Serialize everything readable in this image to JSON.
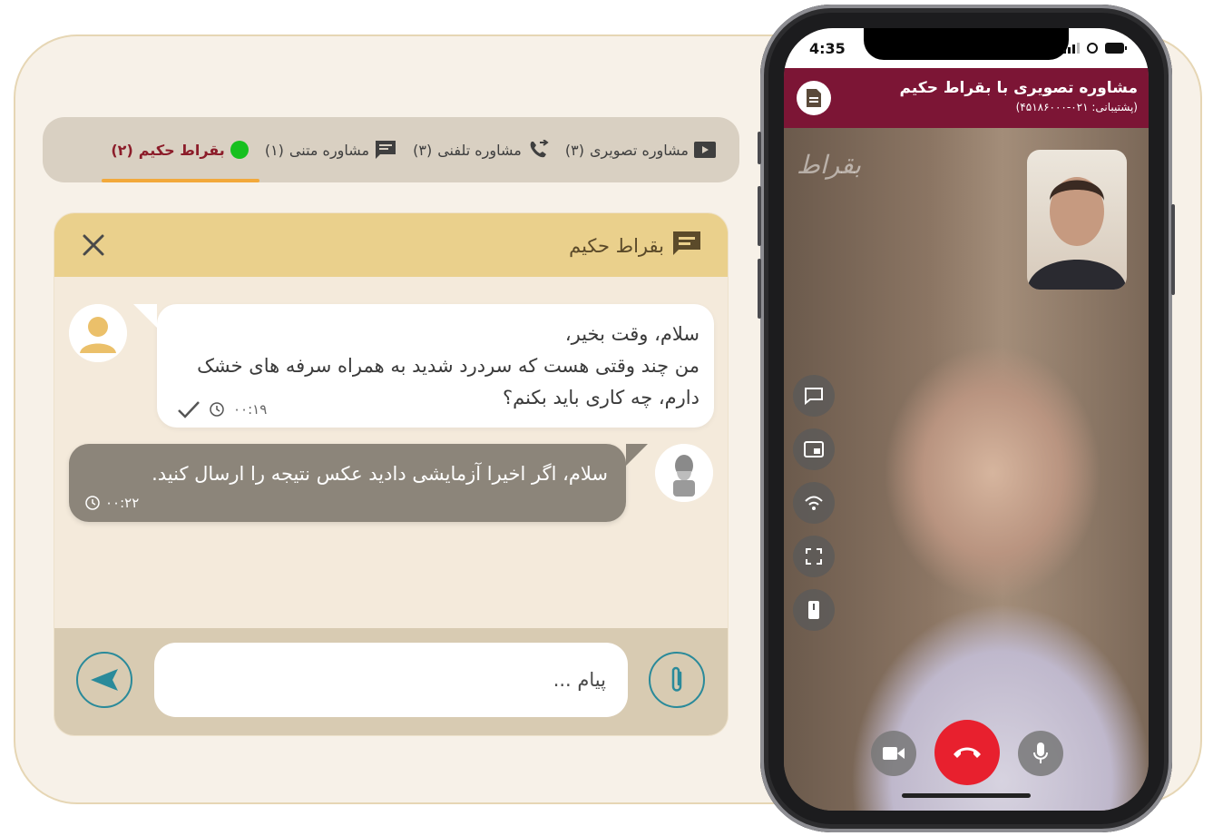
{
  "tabs": [
    {
      "label": "مشاوره تصویری",
      "count": "(۳)",
      "icon": "video-icon"
    },
    {
      "label": "مشاوره تلفنی",
      "count": "(۳)",
      "icon": "phone-call-icon"
    },
    {
      "label": "مشاوره متنی",
      "count": "(۱)",
      "icon": "chat-icon"
    },
    {
      "label": "بقراط حکیم",
      "count": "(۲)",
      "icon": "online-dot",
      "active": true
    }
  ],
  "chat": {
    "title": "بقراط حکیم",
    "messages": [
      {
        "text": "سلام، وقت بخیر،\nمن چند وقتی هست که سردرد شدید به همراه سرفه های خشک دارم، چه کاری باید بکنم؟",
        "time": "۰۰:۱۹",
        "status": "sent"
      },
      {
        "text": "سلام، اگر اخیرا آزمایشی دادید عکس نتیجه را ارسال کنید.",
        "time": "۰۰:۲۲"
      }
    ],
    "input_placeholder": "پیام ..."
  },
  "phone": {
    "time": "4:35",
    "app_title": "مشاوره تصویری با بقراط حکیم",
    "app_subtitle": "(پشتیبانی: ۰۲۱-۴۵۱۸۶۰۰۰)",
    "watermark": "بقراط"
  },
  "colors": {
    "accent_tab": "#f2a93b",
    "appbar": "#7c1535",
    "chat_header": "#ead08c",
    "end_call": "#e8202e",
    "online": "#17c01f"
  }
}
